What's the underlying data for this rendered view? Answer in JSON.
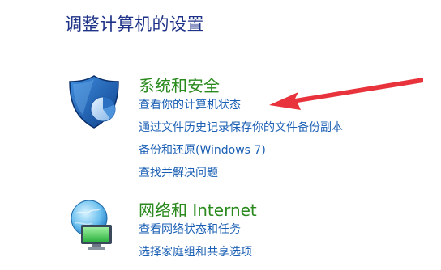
{
  "page": {
    "title": "调整计算机的设置"
  },
  "categories": [
    {
      "icon": "shield-icon",
      "title": "系统和安全",
      "links": [
        "查看你的计算机状态",
        "通过文件历史记录保存你的文件备份副本",
        "备份和还原(Windows 7)",
        "查找并解决问题"
      ]
    },
    {
      "icon": "network-globe-icon",
      "title": "网络和 Internet",
      "links": [
        "查看网络状态和任务",
        "选择家庭组和共享选项"
      ]
    }
  ],
  "colors": {
    "title_blue": "#1e3287",
    "category_green": "#2a8a1e",
    "link_blue": "#1a5fb4",
    "arrow_red": "#e8323c"
  },
  "annotation": {
    "icon": "red-arrow-icon"
  }
}
